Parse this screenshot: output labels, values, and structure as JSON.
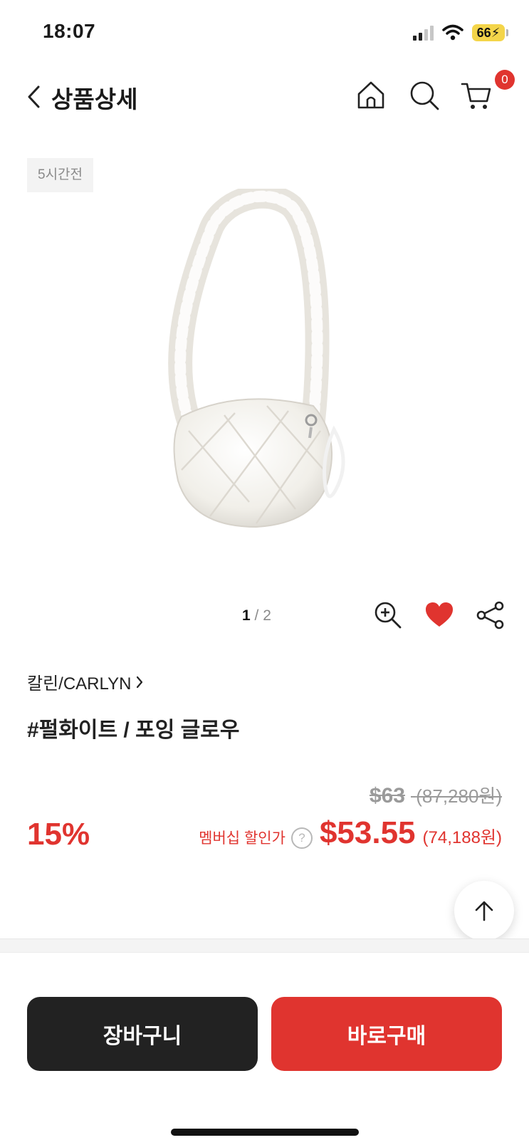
{
  "status_bar": {
    "time": "18:07",
    "battery": "66"
  },
  "header": {
    "title": "상품상세",
    "cart_count": "0"
  },
  "product": {
    "posted": "5시간전",
    "image_index": "1",
    "image_total": "/ 2",
    "brand": "칼린/CARLYN",
    "name": "#펄화이트 / 포잉 글로우",
    "original_price_usd": "$63",
    "original_price_krw": "(87,280원)",
    "discount": "15%",
    "member_label": "멤버십 할인가",
    "help_symbol": "?",
    "sale_price_usd": "$53.55",
    "sale_price_krw": "(74,188원)"
  },
  "actions": {
    "cart_label": "장바구니",
    "buy_label": "바로구매"
  },
  "colors": {
    "accent": "#e0342f",
    "dark": "#222222",
    "muted": "#9a9a9a"
  },
  "icons": [
    "back-icon",
    "home-icon",
    "search-icon",
    "cart-icon",
    "zoom-in-icon",
    "heart-icon",
    "share-icon",
    "arrow-up-icon"
  ]
}
